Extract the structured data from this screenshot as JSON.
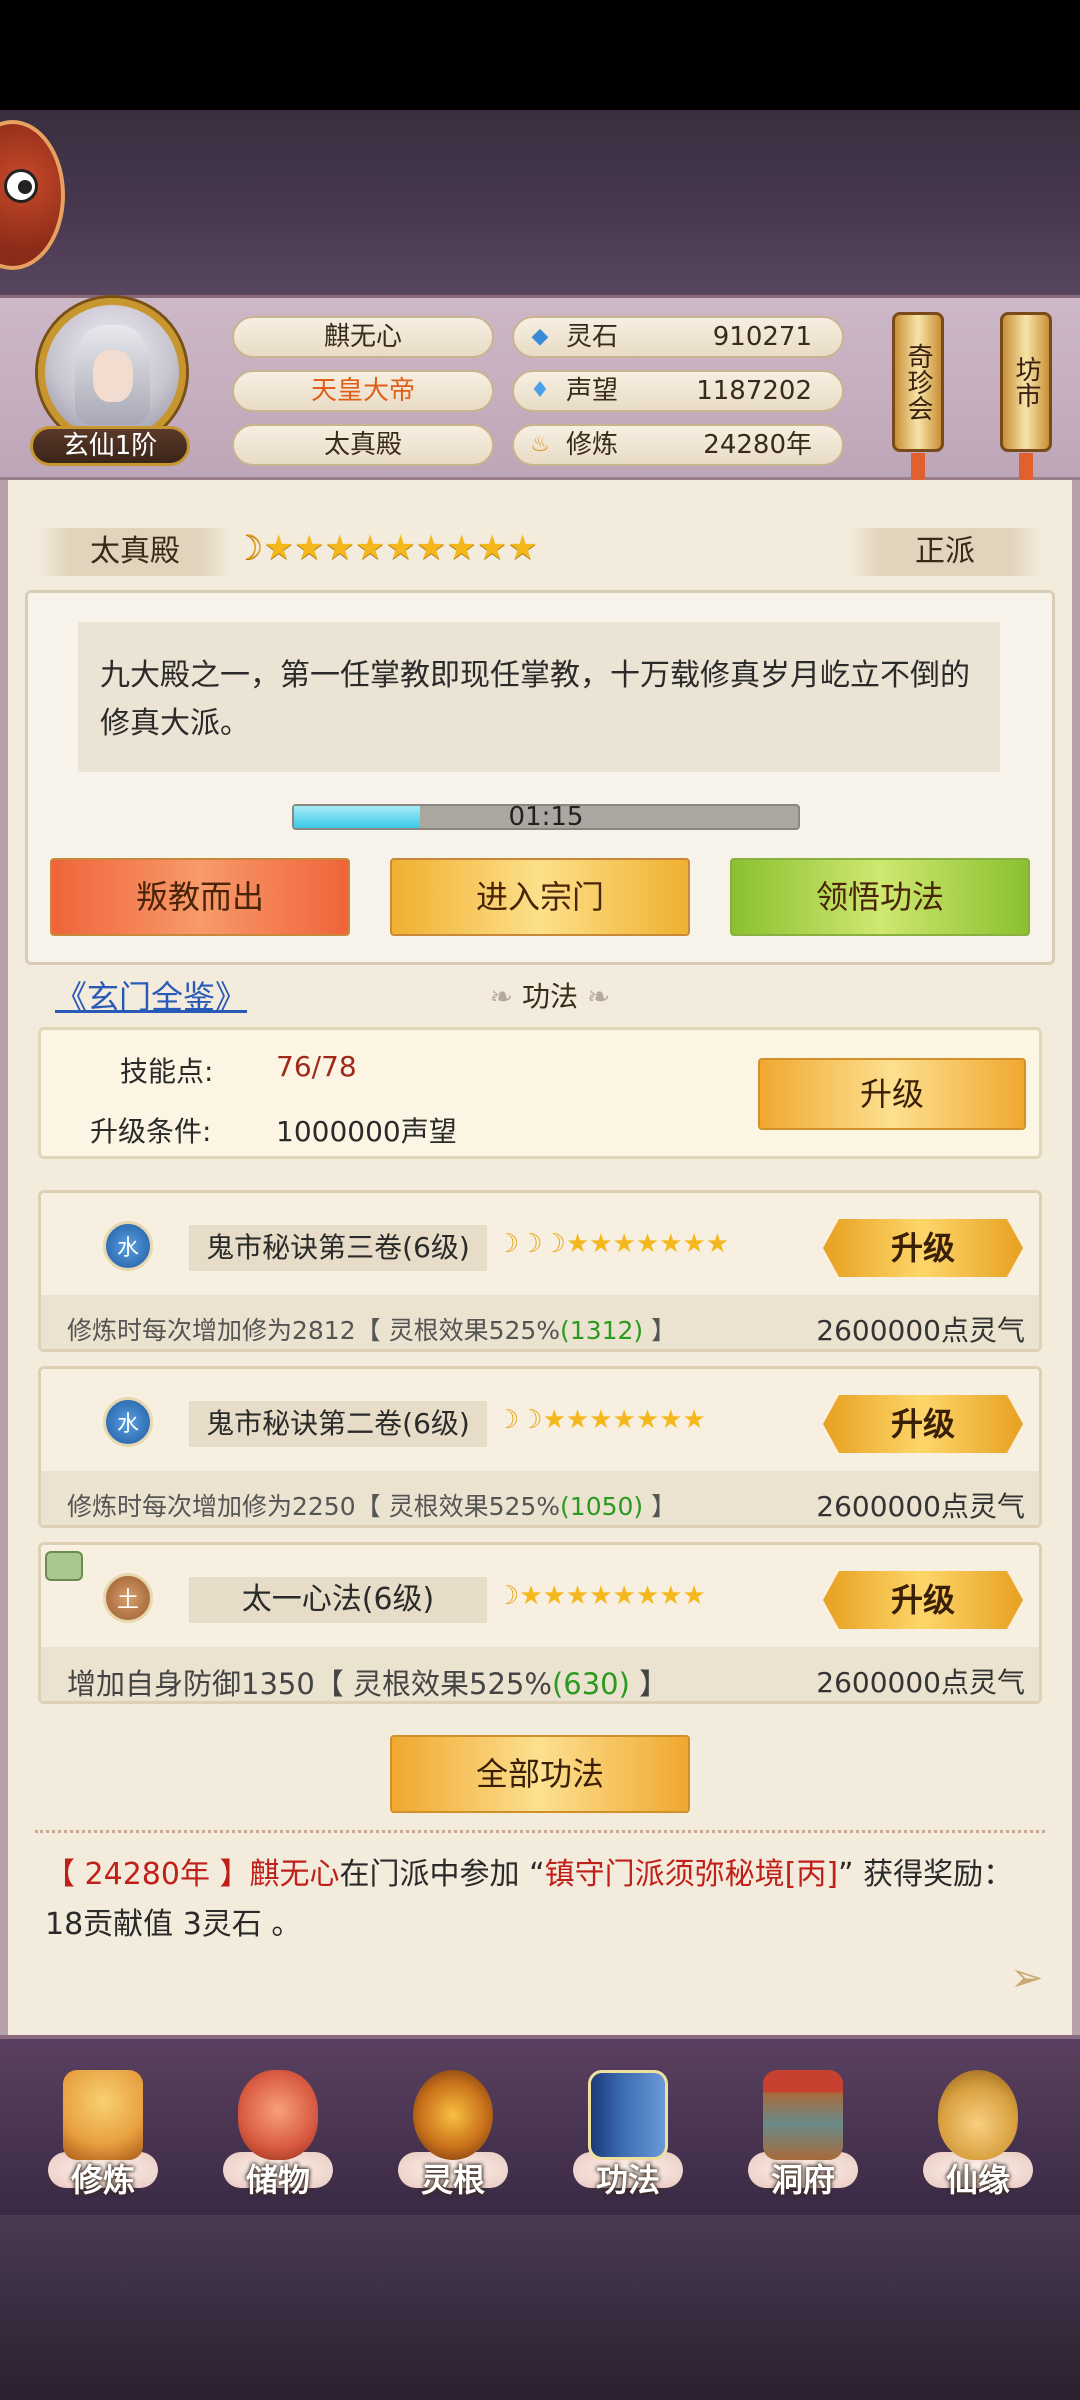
{
  "player": {
    "name": "麒无心",
    "title": "天皇大帝",
    "sect": "太真殿",
    "rank": "玄仙1阶"
  },
  "resources": [
    {
      "label": "灵石",
      "value": "910271",
      "icon": "spirit-stone-icon"
    },
    {
      "label": "声望",
      "value": "1187202",
      "icon": "reputation-icon"
    },
    {
      "label": "修炼",
      "value": "24280年",
      "icon": "cultivation-icon"
    }
  ],
  "side_buttons": {
    "treasure": "奇珍会",
    "market": "坊市"
  },
  "sect_info": {
    "name": "太真殿",
    "alignment": "正派",
    "stars": "☆☆☆☆☆☆☆☆☆",
    "description": "九大殿之一，第一任掌教即现任掌教，十万载修真岁月屹立不倒的修真大派。",
    "timer": "01:15",
    "timer_progress": 0.25
  },
  "actions": {
    "leave": "叛教而出",
    "enter": "进入宗门",
    "comprehend": "领悟功法"
  },
  "section": {
    "link": "《玄门全鉴》",
    "title": "功法"
  },
  "skill_points": {
    "points_label": "技能点:",
    "points_value": "76/78",
    "cond_label": "升级条件:",
    "cond_value": "1000000声望",
    "upgrade": "升级"
  },
  "skills": [
    {
      "element": "水",
      "name": "鬼市秘诀第三卷(6级)",
      "desc_pre": "修炼时每次增加修为2812【 灵根效果525%",
      "desc_bonus": "(1312)",
      "desc_post": " 】",
      "cost": "2600000点灵气",
      "button": "升级"
    },
    {
      "element": "水",
      "name": "鬼市秘诀第二卷(6级)",
      "desc_pre": "修炼时每次增加修为2250【 灵根效果525%",
      "desc_bonus": "(1050)",
      "desc_post": " 】",
      "cost": "2600000点灵气",
      "button": "升级"
    },
    {
      "element": "土",
      "name": "太一心法(6级)",
      "desc_pre": "增加自身防御1350【 灵根效果525%",
      "desc_bonus": "(630)",
      "desc_post": " 】",
      "cost": "2600000点灵气",
      "button": "升级"
    }
  ],
  "all_skills_button": "全部功法",
  "log": {
    "year": "24280年",
    "name": "麒无心",
    "mid": "在门派中参加 “",
    "event": "镇守门派须弥秘境[丙]",
    "post": "” 获得奖励：18贡献值 3灵石 。"
  },
  "nav": [
    {
      "label": "修炼",
      "icon": "cultivate-icon",
      "color": "#e8a040"
    },
    {
      "label": "储物",
      "icon": "storage-bag-icon",
      "color": "#d85a40"
    },
    {
      "label": "灵根",
      "icon": "spirit-root-icon",
      "color": "#c8701a"
    },
    {
      "label": "功法",
      "icon": "skill-book-icon",
      "color": "#3a6ab0"
    },
    {
      "label": "洞府",
      "icon": "cave-dwelling-icon",
      "color": "#a86a3a"
    },
    {
      "label": "仙缘",
      "icon": "fortune-gourd-icon",
      "color": "#d8a040"
    }
  ]
}
